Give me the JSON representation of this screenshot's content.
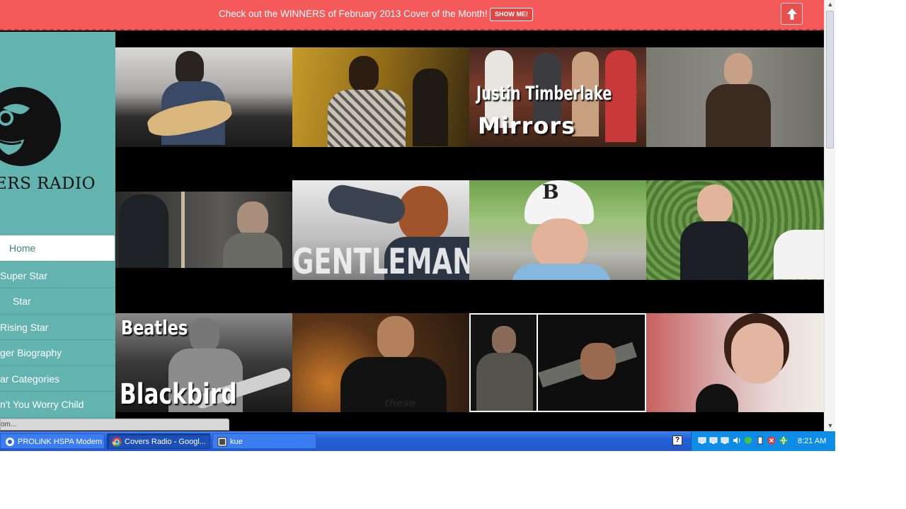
{
  "banner": {
    "text": "Check out the WINNERS of February 2013 Cover of the Month!",
    "button_label": "SHOW ME!"
  },
  "sidebar": {
    "logo_text": "ERS RADIO",
    "nav": [
      {
        "label": "Home",
        "active": true
      },
      {
        "label": "Super Star"
      },
      {
        "label": "Star"
      },
      {
        "label": "Rising Star"
      },
      {
        "label": "ger Biography"
      },
      {
        "label": "ar Categories"
      },
      {
        "label": "n't You Worry Child"
      }
    ]
  },
  "grid": {
    "overlays": {
      "jt_line1": "Justin Timberlake",
      "jt_line2": "Mirrors",
      "gentleman": "GENTLEMAN",
      "beatles": "Beatles",
      "blackbird": "Blackbird",
      "cap_letter": "B",
      "shirt_text": "these"
    }
  },
  "statusbar": {
    "text": "om..."
  },
  "taskbar": {
    "tasks": [
      {
        "label": "PROLiNK HSPA Modem",
        "icon": "modem-icon"
      },
      {
        "label": "Covers Radio - Googl...",
        "icon": "chrome-icon"
      },
      {
        "label": "kue",
        "icon": "app-icon"
      }
    ],
    "help_label": "?",
    "clock": "8:21 AM"
  },
  "colors": {
    "banner": "#f45a5a",
    "sidebar": "#63b3b0",
    "taskbar": "#2460d6",
    "tray": "#0f8de6"
  }
}
